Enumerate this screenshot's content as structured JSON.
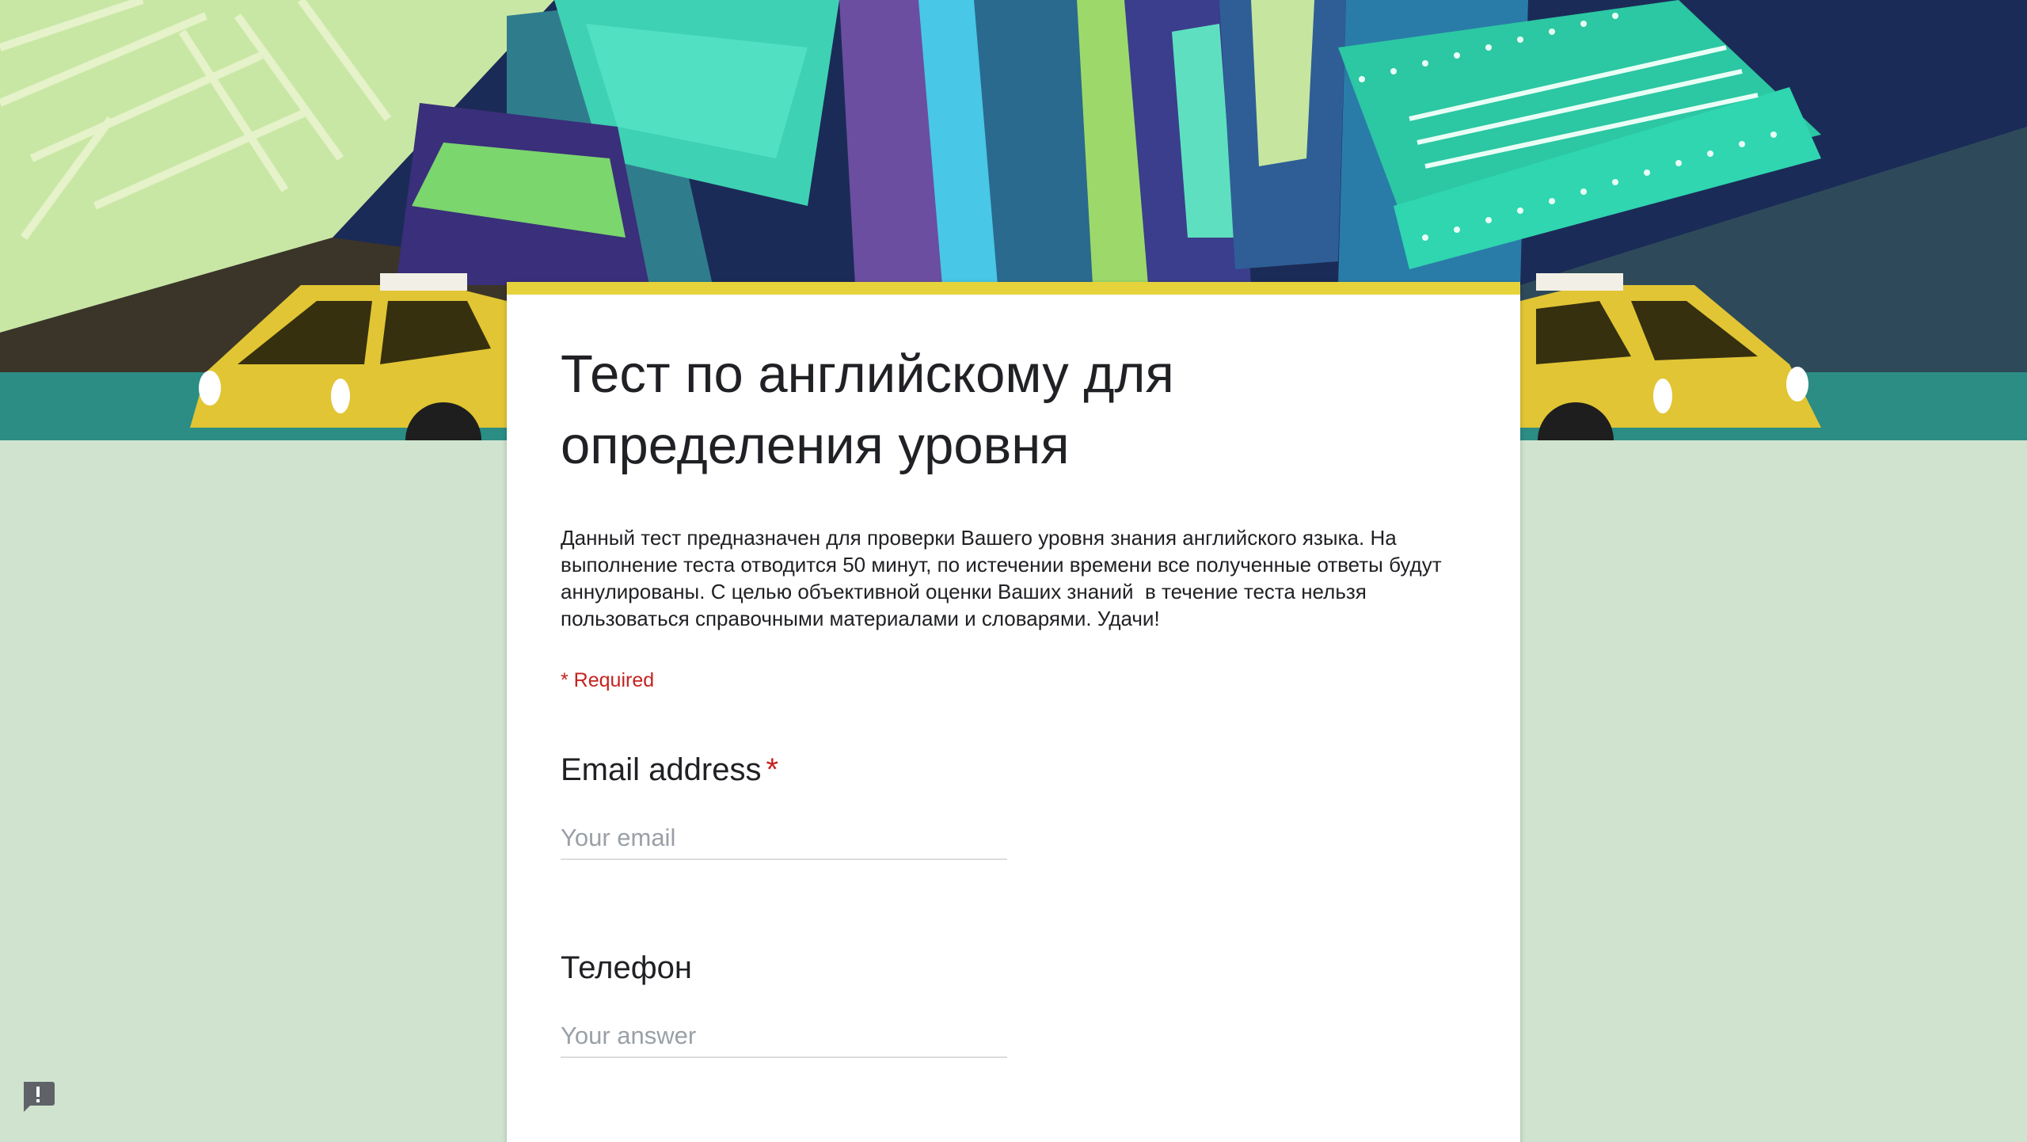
{
  "form": {
    "title": "Тест по английскому для определения уровня",
    "description": "Данный тест предназначен для проверки Вашего уровня знания английского языка. На выполнение теста отводится 50 минут, по истечении времени все полученные ответы будут аннулированы. С целью объективной оценки Ваших знаний  в течение теста нельзя пользоваться справочными материалами и словарями. Удачи!",
    "required_note": "* Required"
  },
  "questions": [
    {
      "title": "Email address",
      "required_marker": "*",
      "placeholder": "Your email"
    },
    {
      "title": "Телефон",
      "placeholder": "Your answer"
    }
  ],
  "icons": {
    "banner": "city-taxi-illustration",
    "report": "report-problem-icon"
  },
  "colors": {
    "page_background": "#cfe3cf",
    "card_background": "#ffffff",
    "accent": "#e6d33c",
    "required": "#c5221f",
    "placeholder": "#9aa0a6",
    "input_underline": "#dadce0"
  }
}
